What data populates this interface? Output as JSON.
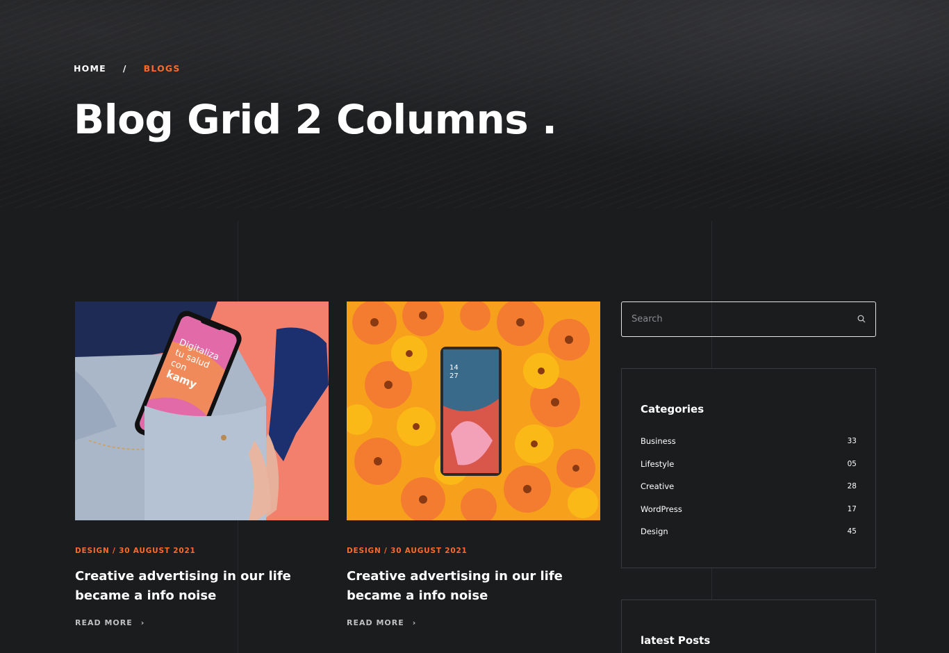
{
  "breadcrumb": {
    "home": "HOME",
    "separator": "/",
    "current": "BLOGS"
  },
  "page_title": "Blog Grid 2 Columns .",
  "posts": [
    {
      "meta": "DESIGN / 30 AUGUST 2021",
      "title": "Creative advertising in our life became a info noise",
      "read_more": "READ MORE",
      "image": {
        "screen_text": [
          "Digitaliza",
          "tu salud",
          "con"
        ],
        "screen_logo": "kamy"
      }
    },
    {
      "meta": "DESIGN / 30 AUGUST 2021",
      "title": "Creative advertising in our life became a info noise",
      "read_more": "READ MORE",
      "image": {
        "clock_hour": "14",
        "clock_minute": "27"
      }
    }
  ],
  "search": {
    "placeholder": "Search",
    "value": ""
  },
  "categories": {
    "title": "Categories",
    "items": [
      {
        "label": "Business",
        "count": "33"
      },
      {
        "label": "Lifestyle",
        "count": "05"
      },
      {
        "label": "Creative",
        "count": "28"
      },
      {
        "label": "WordPress",
        "count": "17"
      },
      {
        "label": "Design",
        "count": "45"
      }
    ]
  },
  "latest_posts": {
    "title": "latest Posts"
  },
  "colors": {
    "background": "#1b1c1e",
    "accent": "#ff6a2b",
    "text": "#ffffff"
  }
}
